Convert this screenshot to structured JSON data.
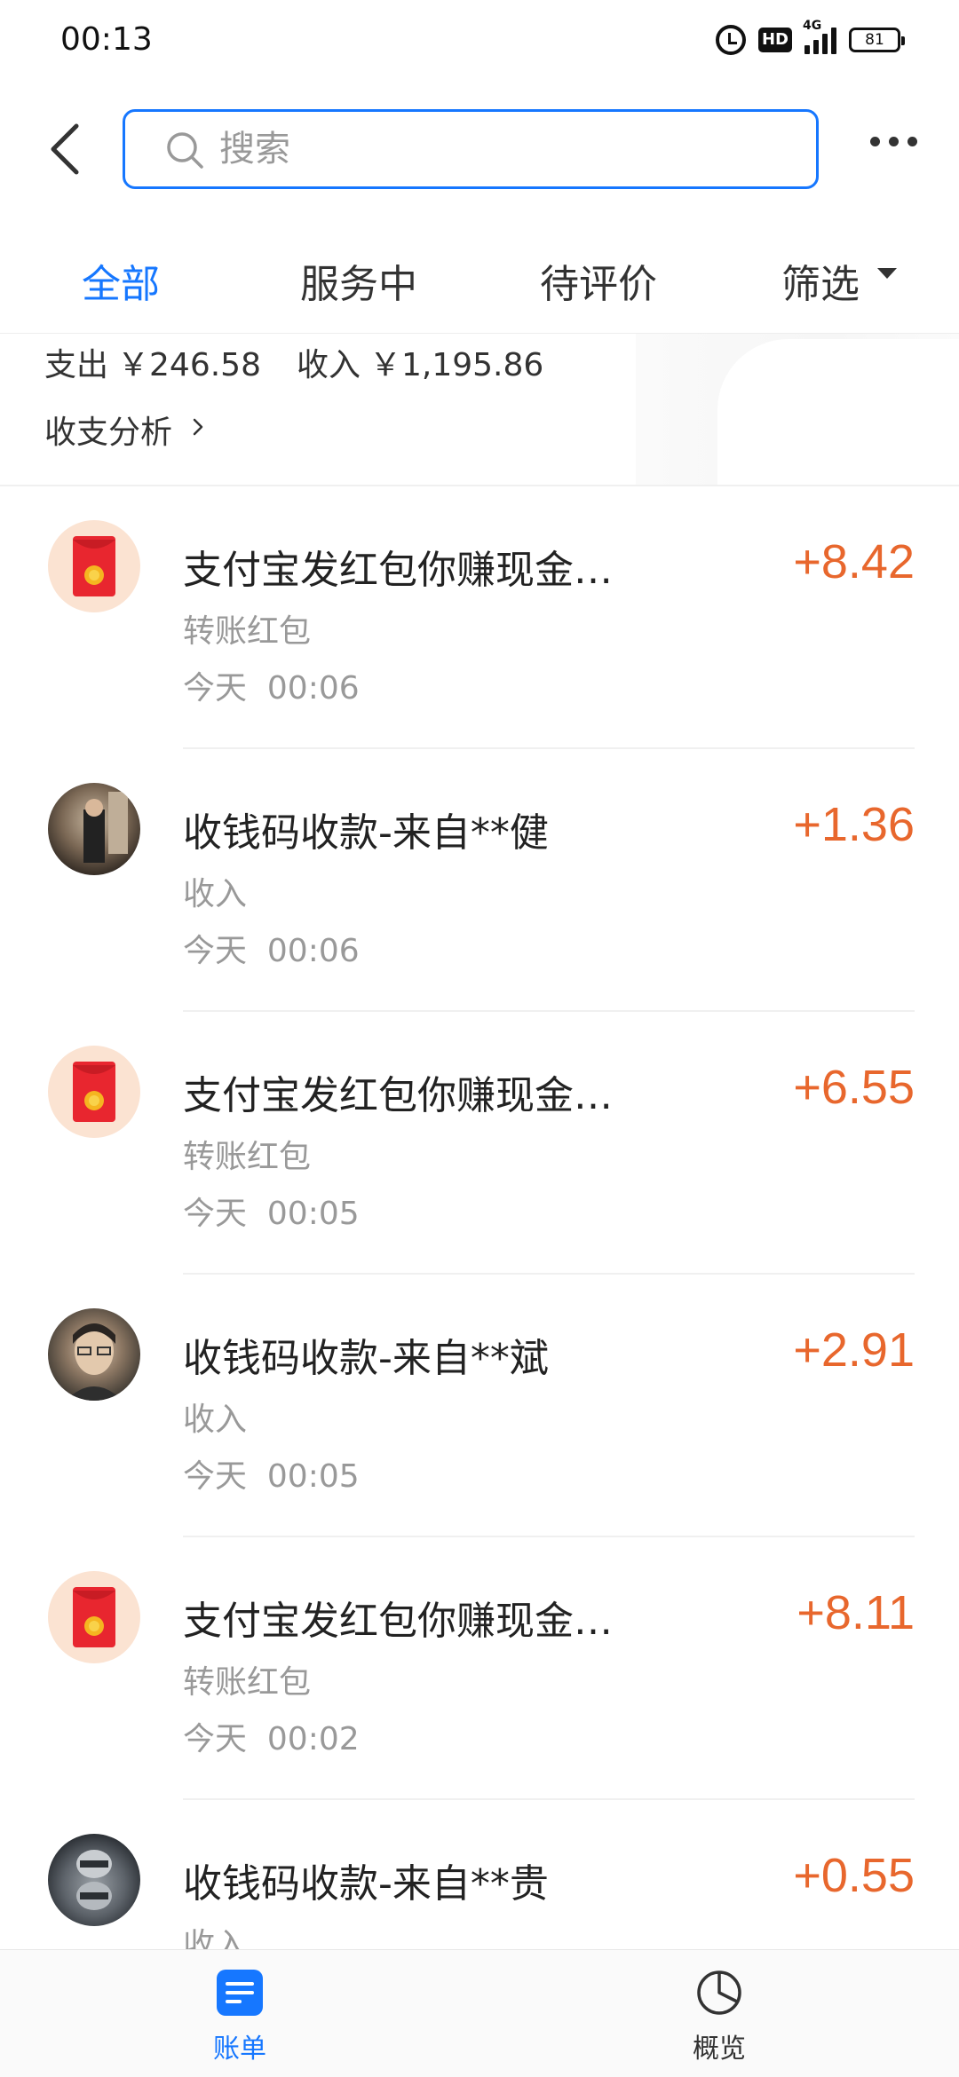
{
  "status_bar": {
    "time": "00:13",
    "network": "4G",
    "hd_label": "HD",
    "battery": "81"
  },
  "header": {
    "search_placeholder": "搜索"
  },
  "tabs": [
    {
      "label": "全部",
      "active": true
    },
    {
      "label": "服务中",
      "active": false
    },
    {
      "label": "待评价",
      "active": false
    },
    {
      "label": "筛选",
      "active": false
    }
  ],
  "summary": {
    "expense_label": "支出",
    "expense_amount": "￥246.58",
    "income_label": "收入",
    "income_amount": "￥1,195.86",
    "analysis_link": "收支分析"
  },
  "transactions": [
    {
      "title": "支付宝发红包你赚现金…",
      "type": "转账红包",
      "day": "今天",
      "time": "00:06",
      "amount": "+8.42",
      "avatar": "red-envelope-icon"
    },
    {
      "title": "收钱码收款-来自**健",
      "type": "收入",
      "day": "今天",
      "time": "00:06",
      "amount": "+1.36",
      "avatar": "user-photo"
    },
    {
      "title": "支付宝发红包你赚现金…",
      "type": "转账红包",
      "day": "今天",
      "time": "00:05",
      "amount": "+6.55",
      "avatar": "red-envelope-icon"
    },
    {
      "title": "收钱码收款-来自**斌",
      "type": "收入",
      "day": "今天",
      "time": "00:05",
      "amount": "+2.91",
      "avatar": "user-photo"
    },
    {
      "title": "支付宝发红包你赚现金…",
      "type": "转账红包",
      "day": "今天",
      "time": "00:02",
      "amount": "+8.11",
      "avatar": "red-envelope-icon"
    },
    {
      "title": "收钱码收款-来自**贵",
      "type": "收入",
      "day": "",
      "time": "",
      "amount": "+0.55",
      "avatar": "user-photo"
    }
  ],
  "bottom_nav": {
    "bills_label": "账单",
    "overview_label": "概览"
  },
  "colors": {
    "accent": "#1677ff",
    "amount": "#e8672d",
    "red_envelope": "#e8262f"
  }
}
